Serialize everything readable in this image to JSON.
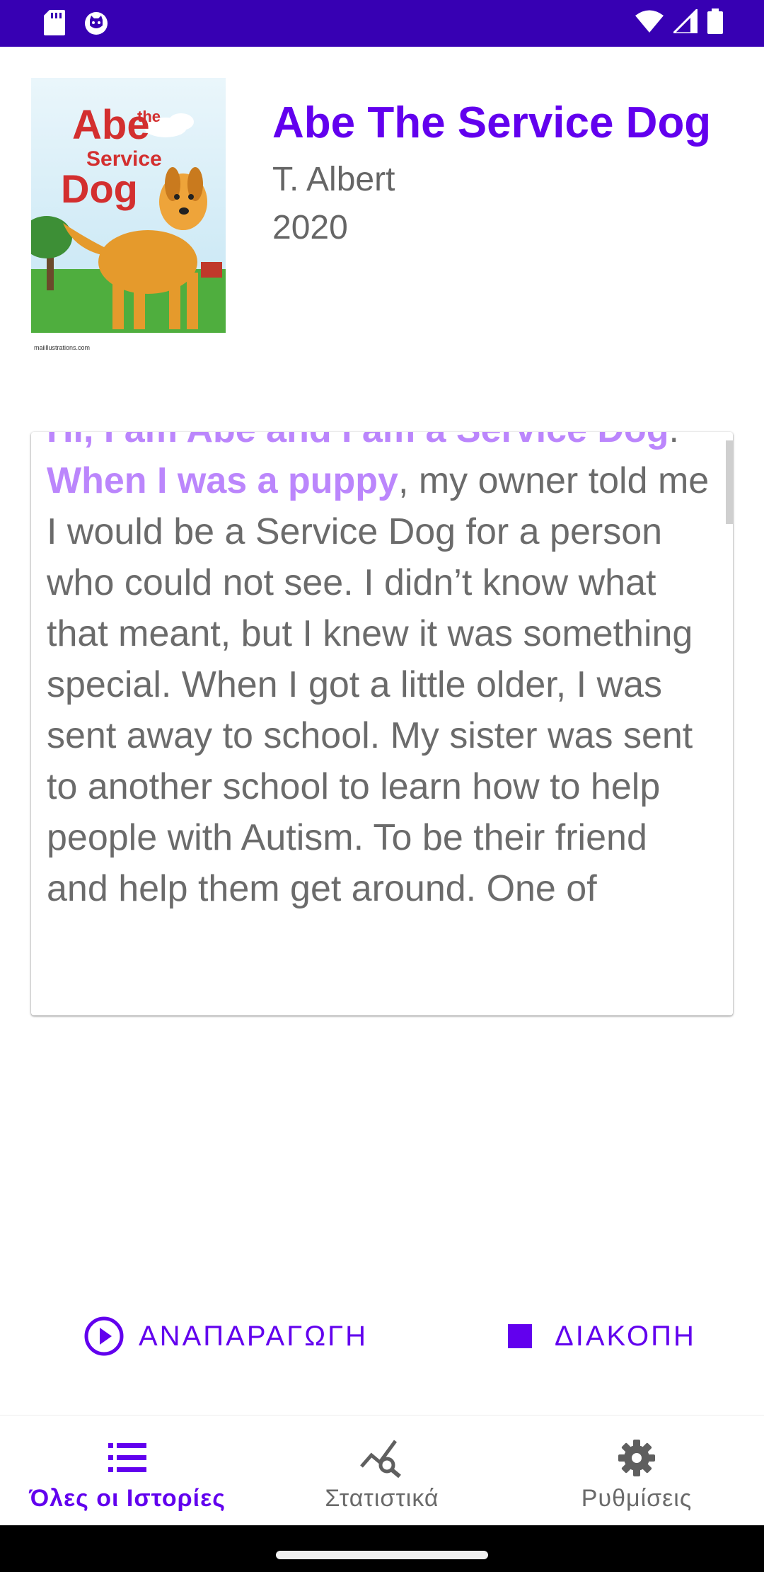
{
  "book": {
    "title": "Abe The Service Dog",
    "author": "T. Albert",
    "year": "2020",
    "cover_title_line1": "Abe",
    "cover_title_sup": "the",
    "cover_title_line2": "Service",
    "cover_title_line3": "Dog",
    "cover_credit": "maiillustrations.com"
  },
  "story": {
    "highlight_1": "Hi, I am Abe and I am a Service Dog",
    "sep": ". ",
    "highlight_2": "When I was a puppy",
    "rest": ", my owner told me I would be a Service Dog for a person who could not see. I didn’t know what that meant, but I knew it was something special. When I got a little older, I was sent away to school. My sister was sent to another school to learn how to help people with Autism. To be their friend and help them get around. One of"
  },
  "controls": {
    "play_label": "ΑΝΑΠΑΡΑΓΩΓΗ",
    "stop_label": "ΔΙΑΚΟΠΗ"
  },
  "nav": {
    "all_stories": "Όλες οι Ιστορίες",
    "stats": "Στατιστικά",
    "settings": "Ρυθμίσεις"
  },
  "colors": {
    "status_bar": "#3700b3",
    "accent": "#6200ee",
    "highlight": "#bb86fc"
  },
  "icons": [
    "sd-card-icon",
    "cat-icon",
    "wifi-icon",
    "signal-icon",
    "battery-icon",
    "play-circle-icon",
    "stop-icon",
    "list-icon",
    "stats-search-icon",
    "gear-icon"
  ]
}
